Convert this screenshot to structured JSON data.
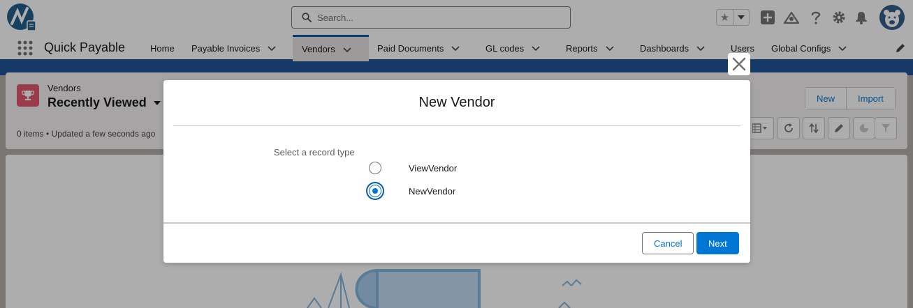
{
  "header": {
    "search_placeholder": "Search...",
    "icons": [
      "favorites-star-icon",
      "chevron-down-icon",
      "add-icon",
      "trailhead-icon",
      "help-icon",
      "gear-icon",
      "bell-icon",
      "avatar"
    ]
  },
  "nav": {
    "app_name": "Quick Payable",
    "items": [
      {
        "label": "Home"
      },
      {
        "label": "Payable Invoices"
      },
      {
        "label": "Vendors"
      },
      {
        "label": "Paid Documents"
      },
      {
        "label": "GL codes"
      },
      {
        "label": "Reports"
      },
      {
        "label": "Dashboards"
      },
      {
        "label": "Users"
      },
      {
        "label": "Global Configs"
      }
    ],
    "active": "Vendors"
  },
  "list": {
    "object_name": "Vendors",
    "view_name": "Recently Viewed",
    "status": "0 items • Updated a few seconds ago",
    "new_label": "New",
    "import_label": "Import"
  },
  "modal": {
    "title": "New Vendor",
    "record_type_label": "Select a record type",
    "options": [
      {
        "label": "ViewVendor",
        "selected": false
      },
      {
        "label": "NewVendor",
        "selected": true
      }
    ],
    "cancel_label": "Cancel",
    "next_label": "Next"
  },
  "colors": {
    "brand_blue": "#0176d3",
    "nav_accent": "#1b5297",
    "object_icon": "#e3566b"
  }
}
